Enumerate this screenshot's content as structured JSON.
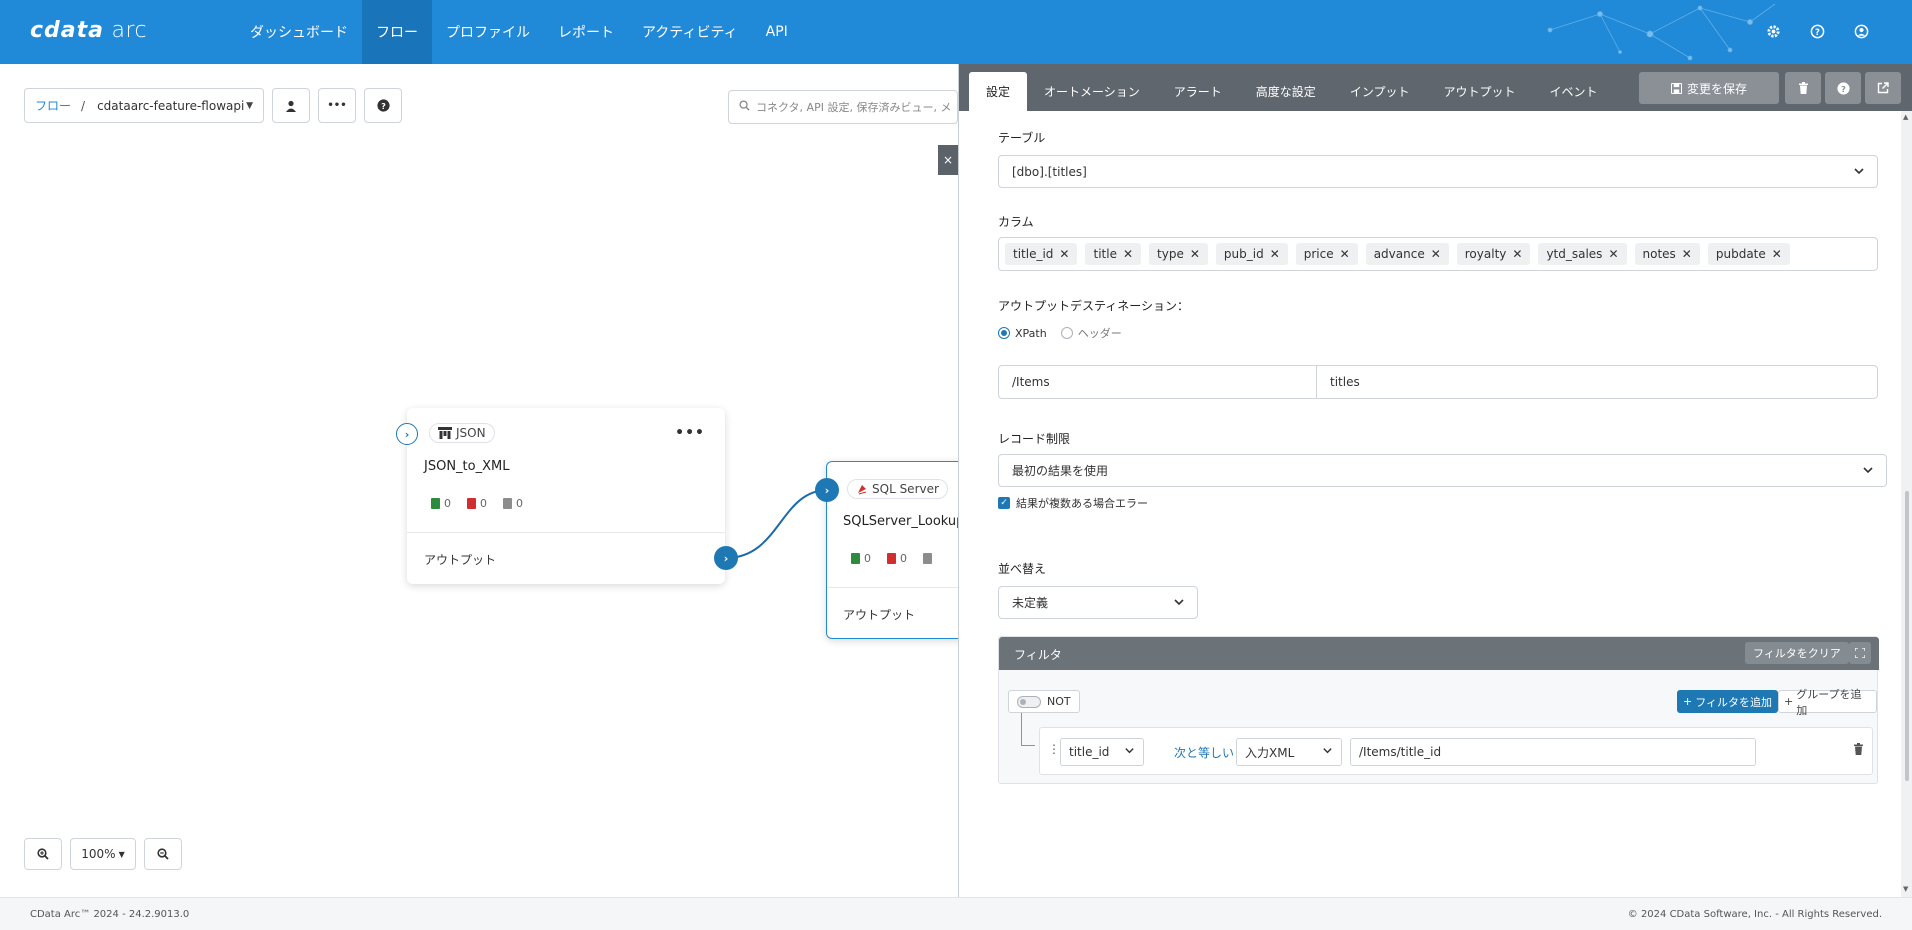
{
  "app": {
    "logo_brand": "cdata",
    "logo_product": "arc"
  },
  "nav": {
    "items": [
      {
        "label": "ダッシュボード"
      },
      {
        "label": "フロー"
      },
      {
        "label": "プロファイル"
      },
      {
        "label": "レポート"
      },
      {
        "label": "アクティビティ"
      },
      {
        "label": "API"
      }
    ],
    "active_index": 1,
    "icons": [
      "gear-icon",
      "help-icon",
      "user-icon"
    ]
  },
  "canvas": {
    "breadcrumb_root": "フロー",
    "breadcrumb_sep": "/",
    "breadcrumb_current": "cdataarc-feature-flowapi",
    "search_placeholder": "コネクタ, API 設定, 保存済みビュー, メ",
    "zoom_level": "100%",
    "close_label": "×",
    "nodes": [
      {
        "badge": "JSON",
        "badge_icon": "json-icon",
        "title": "JSON_to_XML",
        "stats": [
          "0",
          "0",
          "0"
        ],
        "output_label": "アウトプット",
        "menu": "•••"
      },
      {
        "badge": "SQL Server",
        "badge_icon": "sqlserver-icon",
        "title": "SQLServer_Lookup",
        "stats": [
          "0",
          "0"
        ],
        "output_label": "アウトプット"
      }
    ]
  },
  "panel": {
    "tabs": [
      {
        "label": "設定"
      },
      {
        "label": "オートメーション"
      },
      {
        "label": "アラート"
      },
      {
        "label": "高度な設定"
      },
      {
        "label": "インプット"
      },
      {
        "label": "アウトプット"
      },
      {
        "label": "イベント"
      }
    ],
    "active_tab_index": 0,
    "save_label": "変更を保存",
    "table_label": "テーブル",
    "table_value": "[dbo].[titles]",
    "columns_label": "カラム",
    "columns": [
      "title_id",
      "title",
      "type",
      "pub_id",
      "price",
      "advance",
      "royalty",
      "ytd_sales",
      "notes",
      "pubdate"
    ],
    "output_dest_label": "アウトプットデスティネーション：",
    "radio_xpath": "XPath",
    "radio_header": "ヘッダー",
    "xpath_value": "/Items",
    "xpath_name": "titles",
    "record_limit_label": "レコード制限",
    "record_limit_value": "最初の結果を使用",
    "error_multiple_label": "結果が複数ある場合エラー",
    "sort_label": "並べ替え",
    "sort_value": "未定義",
    "filter": {
      "title": "フィルタ",
      "clear_label": "フィルタをクリア",
      "not_label": "NOT",
      "add_filter_label": "フィルタを追加",
      "add_group_label": "グループを追加",
      "rule": {
        "field": "title_id",
        "operator": "次と等しい",
        "source": "入力XML",
        "value": "/Items/title_id"
      }
    }
  },
  "footer": {
    "left": "CData Arc™ 2024 - 24.2.9013.0",
    "right": "© 2024 CData Software, Inc. - All Rights Reserved."
  },
  "colors": {
    "brand_blue": "#2089d8",
    "panel_header": "#5f666d",
    "accent": "#1e78b4"
  }
}
